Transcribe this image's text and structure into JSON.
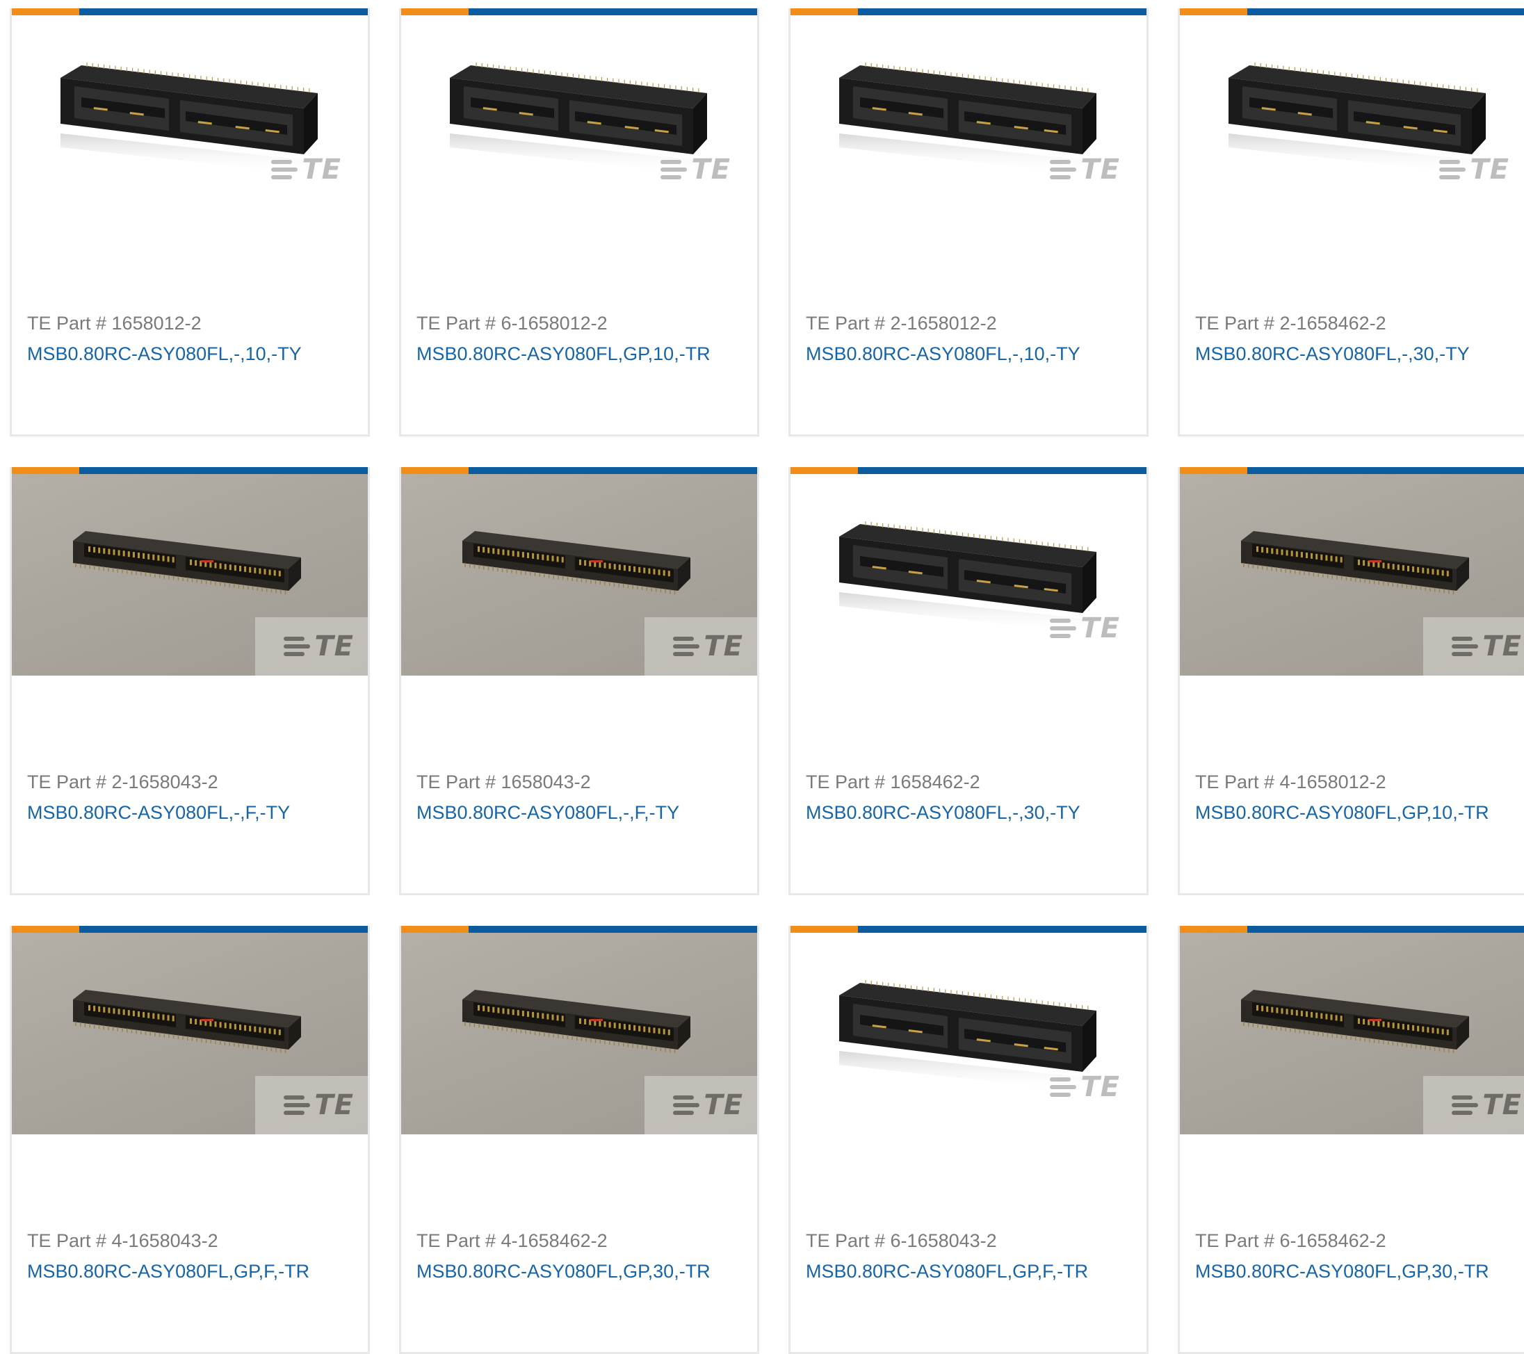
{
  "colors": {
    "accent_orange": "#f28d1a",
    "accent_blue": "#0d5b9f",
    "link_blue": "#1565a8",
    "part_gray": "#7a7a7a",
    "card_border": "#e8e8e8"
  },
  "cards": [
    {
      "part_number": "TE Part # 1658012-2",
      "name": "MSB0.80RC-ASY080FL,-,10,-TY",
      "image_style": "white-render",
      "logo": "TE"
    },
    {
      "part_number": "TE Part # 6-1658012-2",
      "name": "MSB0.80RC-ASY080FL,GP,10,-TR",
      "image_style": "white-render",
      "logo": "TE"
    },
    {
      "part_number": "TE Part # 2-1658012-2",
      "name": "MSB0.80RC-ASY080FL,-,10,-TY",
      "image_style": "white-render",
      "logo": "TE"
    },
    {
      "part_number": "TE Part # 2-1658462-2",
      "name": "MSB0.80RC-ASY080FL,-,30,-TY",
      "image_style": "white-render",
      "logo": "TE"
    },
    {
      "part_number": "TE Part # 2-1658043-2",
      "name": "MSB0.80RC-ASY080FL,-,F,-TY",
      "image_style": "gray-photo",
      "logo": "TE"
    },
    {
      "part_number": "TE Part # 1658043-2",
      "name": "MSB0.80RC-ASY080FL,-,F,-TY",
      "image_style": "gray-photo",
      "logo": "TE"
    },
    {
      "part_number": "TE Part # 1658462-2",
      "name": "MSB0.80RC-ASY080FL,-,30,-TY",
      "image_style": "white-render",
      "logo": "TE"
    },
    {
      "part_number": "TE Part # 4-1658012-2",
      "name": "MSB0.80RC-ASY080FL,GP,10,-TR",
      "image_style": "gray-photo",
      "logo": "TE"
    },
    {
      "part_number": "TE Part # 4-1658043-2",
      "name": "MSB0.80RC-ASY080FL,GP,F,-TR",
      "image_style": "gray-photo",
      "logo": "TE"
    },
    {
      "part_number": "TE Part # 4-1658462-2",
      "name": "MSB0.80RC-ASY080FL,GP,30,-TR",
      "image_style": "gray-photo",
      "logo": "TE"
    },
    {
      "part_number": "TE Part # 6-1658043-2",
      "name": "MSB0.80RC-ASY080FL,GP,F,-TR",
      "image_style": "white-render",
      "logo": "TE"
    },
    {
      "part_number": "TE Part # 6-1658462-2",
      "name": "MSB0.80RC-ASY080FL,GP,30,-TR",
      "image_style": "gray-photo",
      "logo": "TE"
    }
  ]
}
